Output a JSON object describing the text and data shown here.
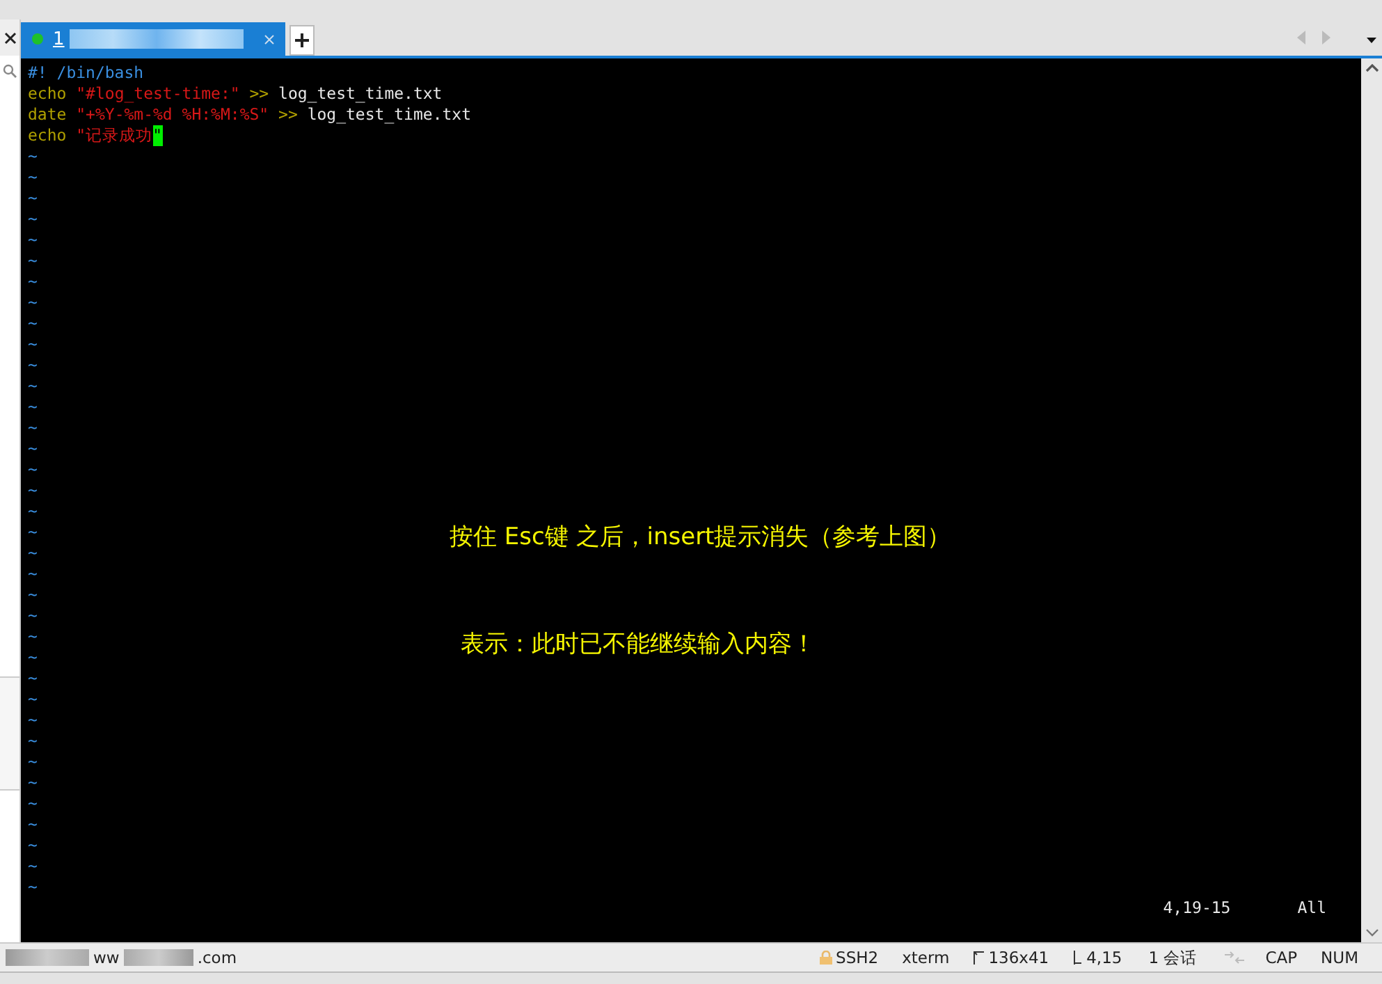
{
  "tabs": [
    {
      "label": "1",
      "selected": true,
      "connected": true
    }
  ],
  "editor": {
    "lines": [
      [
        {
          "kind": "comment",
          "text": "#! /bin/bash"
        }
      ],
      [
        {
          "kind": "keyword",
          "text": "echo "
        },
        {
          "kind": "string",
          "text": "\"#log_test-time:\""
        },
        {
          "kind": "operator",
          "text": " >> "
        },
        {
          "kind": "plain",
          "text": "log_test_time.txt"
        }
      ],
      [
        {
          "kind": "keyword",
          "text": "date "
        },
        {
          "kind": "string",
          "text": "\"+%Y-%m-%d %H:%M:%S\""
        },
        {
          "kind": "operator",
          "text": " >> "
        },
        {
          "kind": "plain",
          "text": "log_test_time.txt"
        }
      ],
      [
        {
          "kind": "keyword",
          "text": "echo "
        },
        {
          "kind": "string",
          "text": "\"记录成功"
        },
        {
          "kind": "cursor",
          "text": "\""
        }
      ]
    ],
    "tildes": [
      "~",
      "~",
      "~",
      "~",
      "~",
      "~",
      "~",
      "~",
      "~",
      "~",
      "~",
      "~",
      "~",
      "~",
      "~",
      "~",
      "~",
      "~",
      "~",
      "~",
      "~",
      "~",
      "~",
      "~",
      "~",
      "~",
      "~",
      "~",
      "~",
      "~",
      "~",
      "~",
      "~",
      "~",
      "~",
      "~"
    ],
    "annotations": [
      "按住 Esc键 之后，insert提示消失（参考上图）",
      "表示：此时已不能继续输入内容！"
    ],
    "position": "4,19-15",
    "scroll": "All"
  },
  "status_bar": {
    "host_start": "ww",
    "host_end": ".com",
    "protocol": "SSH2",
    "terminal": "xterm",
    "size": "136x41",
    "cursor": "4,15",
    "sessions": "1 会话",
    "caps": "CAP",
    "num": "NUM"
  }
}
